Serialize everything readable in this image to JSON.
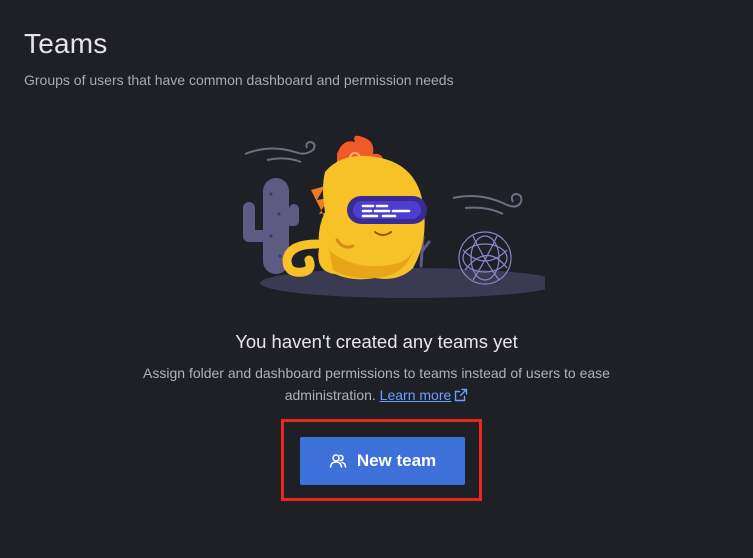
{
  "header": {
    "title": "Teams",
    "subtitle": "Groups of users that have common dashboard and permission needs"
  },
  "empty_state": {
    "title": "You haven't created any teams yet",
    "description": "Assign folder and dashboard permissions to teams instead of users to ease administration.",
    "link_label": "Learn more",
    "illustration_icon": "grafana-mascot-desert-illustration"
  },
  "actions": {
    "new_team_label": "New team",
    "new_team_icon": "users-icon"
  },
  "colors": {
    "background": "#1f1f26",
    "primary_button": "#3d71d9",
    "link": "#6e9fff",
    "highlight": "#e8261f"
  }
}
